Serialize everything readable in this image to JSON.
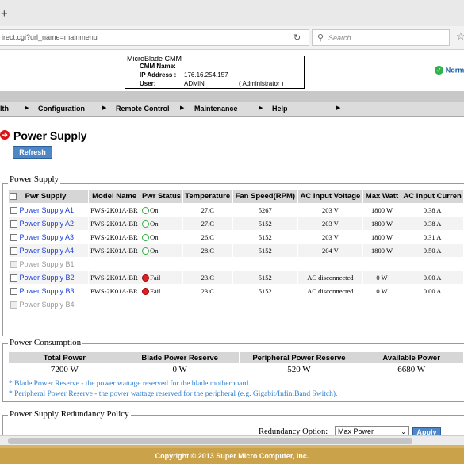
{
  "browser": {
    "new_tab_glyph": "+",
    "url": "irect.cgi?url_name=mainmenu",
    "search_placeholder": "Search",
    "reload_icon": "reload-icon",
    "star_icon": "star-icon"
  },
  "header": {
    "cmm_title": "MicroBlade CMM",
    "cmm_name_label": "CMM Name:",
    "cmm_name_value": "",
    "ip_label": "IP Address :",
    "ip_value": "176.16.254.157",
    "user_label": "User:",
    "user_value": "ADMIN",
    "user_role": "( Administrator )",
    "status_text": "Norm",
    "status_color": "#2db34a"
  },
  "menu": {
    "items": [
      {
        "label": "lth"
      },
      {
        "label": "Configuration"
      },
      {
        "label": "Remote Control"
      },
      {
        "label": "Maintenance"
      },
      {
        "label": "Help"
      }
    ]
  },
  "page": {
    "title": "Power Supply",
    "refresh_label": "Refresh"
  },
  "power_supply": {
    "legend": "Power Supply",
    "headers": [
      "Pwr Supply",
      "Model Name",
      "Pwr Status",
      "Temperature",
      "Fan Speed(RPM)",
      "AC Input Voltage",
      "Max Watt",
      "AC Input Curren"
    ],
    "rows": [
      {
        "name": "Power Supply A1",
        "model": "PWS-2K01A-BR",
        "status": "On",
        "temp": "27.C",
        "fan": "5267",
        "voltage": "203 V",
        "watt": "1800 W",
        "current": "0.38 A"
      },
      {
        "name": "Power Supply A2",
        "model": "PWS-2K01A-BR",
        "status": "On",
        "temp": "27.C",
        "fan": "5152",
        "voltage": "203 V",
        "watt": "1800 W",
        "current": "0.38 A"
      },
      {
        "name": "Power Supply A3",
        "model": "PWS-2K01A-BR",
        "status": "On",
        "temp": "26.C",
        "fan": "5152",
        "voltage": "203 V",
        "watt": "1800 W",
        "current": "0.31 A"
      },
      {
        "name": "Power Supply A4",
        "model": "PWS-2K01A-BR",
        "status": "On",
        "temp": "28.C",
        "fan": "5152",
        "voltage": "204 V",
        "watt": "1800 W",
        "current": "0.50 A"
      },
      {
        "name": "Power Supply B1",
        "model": "",
        "status": "",
        "temp": "",
        "fan": "",
        "voltage": "",
        "watt": "",
        "current": ""
      },
      {
        "name": "Power Supply B2",
        "model": "PWS-2K01A-BR",
        "status": "Fail",
        "temp": "23.C",
        "fan": "5152",
        "voltage": "AC disconnected",
        "watt": "0 W",
        "current": "0.00 A"
      },
      {
        "name": "Power Supply B3",
        "model": "PWS-2K01A-BR",
        "status": "Fail",
        "temp": "23.C",
        "fan": "5152",
        "voltage": "AC disconnected",
        "watt": "0 W",
        "current": "0.00 A"
      },
      {
        "name": "Power Supply B4",
        "model": "",
        "status": "",
        "temp": "",
        "fan": "",
        "voltage": "",
        "watt": "",
        "current": ""
      }
    ]
  },
  "consumption": {
    "legend": "Power Consumption",
    "headers": [
      "Total Power",
      "Blade Power Reserve",
      "Peripheral Power Reserve",
      "Available Power"
    ],
    "values": [
      "7200 W",
      "0 W",
      "520 W",
      "6680 W"
    ],
    "notes": [
      "* Blade Power Reserve - the power wattage reserved for the blade motherboard.",
      "* Peripheral Power Reserve - the power wattage reserved for the peripheral (e.g. Gigabit/InfiniBand Switch)."
    ],
    "note_color": "#2f7fd0"
  },
  "redundancy": {
    "legend": "Power Supply Redundancy Policy",
    "option_label": "Redundancy Option:",
    "selected": "Max Power",
    "apply_label": "Apply"
  },
  "footer": {
    "copyright": "Copyright © 2013 Super Micro Computer, Inc."
  },
  "colors": {
    "accent": "#4f86c6",
    "footer": "#c9a24a",
    "link": "#1a3fd6",
    "ok": "#2fae3c",
    "fail": "#e02020"
  }
}
